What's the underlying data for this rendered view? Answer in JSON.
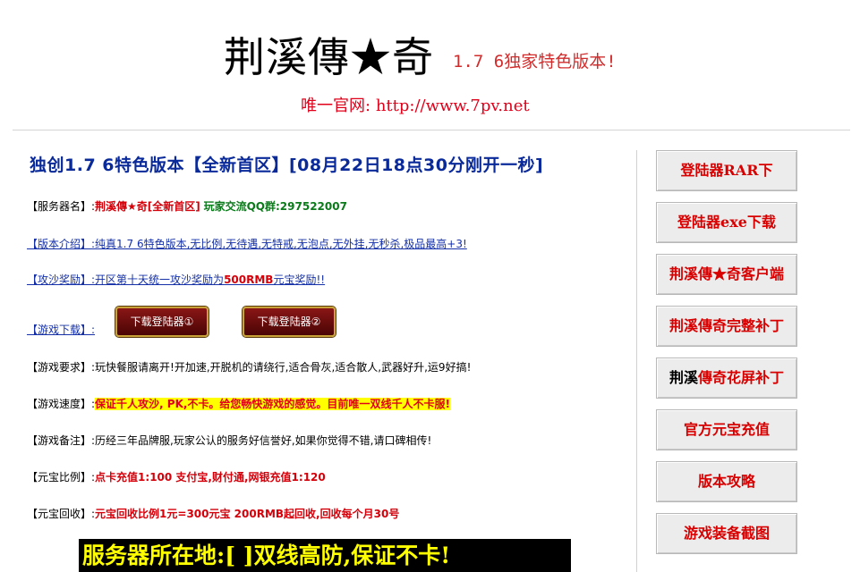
{
  "header": {
    "title_left": "荆溪傳",
    "title_star": "★",
    "title_right": "奇",
    "subtitle": "1.7 6独家特色版本!",
    "official_label": "唯一官网:",
    "official_url": "http://www.7pv.net"
  },
  "main": {
    "headline_a": "独创1.7 6特色版本【全新首区】",
    "headline_b": "[08月22日18点30分刚开一秒]",
    "rows": [
      {
        "label": "【服务器名】:",
        "value": "荆溪傳★奇[全新首区]",
        "extra": "玩家交流QQ群:297522007"
      },
      {
        "label": "【版本介绍】:",
        "value": "纯真1.7 6特色版本,无比例,无待遇,无特戒,无泡点,无外挂,无秒杀,极品最高+3!"
      },
      {
        "label": "【攻沙奖励】:",
        "value": "开区第十天统一攻沙奖励为",
        "value_red": "500RMB",
        "value_tail": "元宝奖励!!"
      },
      {
        "label": "【游戏下载】:"
      },
      {
        "label": "【游戏要求】:",
        "value": "玩快餐服请离开!开加速,开脱机的请绕行,适合骨灰,适合散人,武器好升,运9好搞!"
      },
      {
        "label": "【游戏速度】:",
        "value": "保证千人攻沙, PK,不卡。给您畅快游戏的感觉。目前唯一双线千人不卡服!"
      },
      {
        "label": "【游戏备注】:",
        "value": "历经三年品牌服,玩家公认的服务好信誉好,如果你觉得不错,请口碑相传!"
      },
      {
        "label": "【元宝比例】:",
        "value": "点卡充值1:100 支付宝,财付通,网银充值1:120"
      },
      {
        "label": "【元宝回收】:",
        "value": "元宝回收比例1元=300元宝 200RMB起回收,回收每个月30号"
      }
    ],
    "download_buttons": [
      "下载登陆器①",
      "下载登陆器②"
    ],
    "footer_banner": "服务器所在地:[ ]双线高防,保证不卡!"
  },
  "sidebar": {
    "items": [
      {
        "label": "登陆器RAR下"
      },
      {
        "label": "登陆器exe下载"
      },
      {
        "label": "荆溪傳★奇客户端"
      },
      {
        "label": "荆溪傳奇完整补丁"
      },
      {
        "label_black": "荆溪",
        "label": "傳奇花屏补丁"
      },
      {
        "label": "官方元宝充值"
      },
      {
        "label": "版本攻略"
      },
      {
        "label": "游戏装备截图"
      }
    ]
  },
  "colors": {
    "accent_red": "#d80000",
    "headline_blue": "#0a2a9a",
    "banner_yellow": "#ffff00"
  }
}
